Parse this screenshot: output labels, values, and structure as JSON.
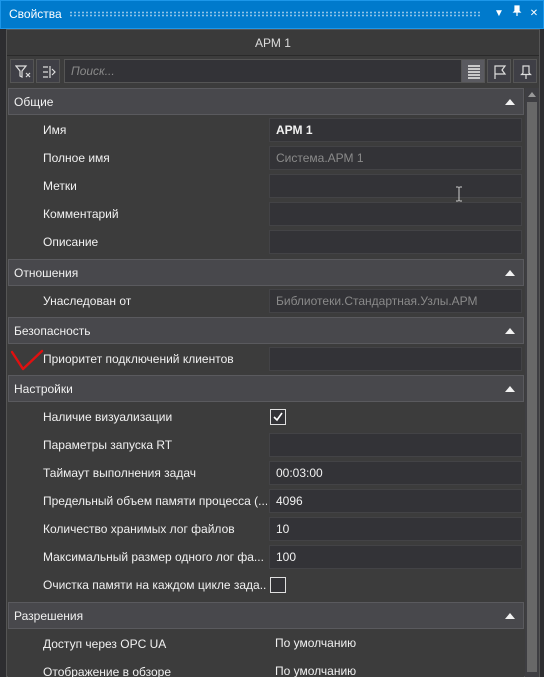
{
  "window": {
    "title": "Свойства"
  },
  "object_name": "АРМ 1",
  "search": {
    "placeholder": "Поиск..."
  },
  "categories": [
    {
      "label": "Общие",
      "rows": [
        {
          "label": "Имя",
          "value": "АРМ 1"
        },
        {
          "label": "Полное имя",
          "value": "Система.АРМ 1"
        },
        {
          "label": "Метки",
          "value": ""
        },
        {
          "label": "Комментарий",
          "value": ""
        },
        {
          "label": "Описание",
          "value": ""
        }
      ]
    },
    {
      "label": "Отношения",
      "rows": [
        {
          "label": "Унаследован от",
          "value": "Библиотеки.Стандартная.Узлы.АРМ"
        }
      ]
    },
    {
      "label": "Безопасность",
      "rows": [
        {
          "label": "Приоритет подключений клиентов",
          "value": ""
        }
      ]
    },
    {
      "label": "Настройки",
      "rows": [
        {
          "label": "Наличие визуализации",
          "checked": true
        },
        {
          "label": "Параметры запуска RT",
          "value": ""
        },
        {
          "label": "Таймаут выполнения задач",
          "value": "00:03:00"
        },
        {
          "label": "Предельный объем памяти процесса (...",
          "value": "4096"
        },
        {
          "label": "Количество хранимых лог файлов",
          "value": "10"
        },
        {
          "label": "Максимальный размер одного лог фа...",
          "value": "100"
        },
        {
          "label": "Очистка памяти на каждом цикле зада...",
          "checked": false
        }
      ]
    },
    {
      "label": "Разрешения",
      "rows": [
        {
          "label": "Доступ через OPC UA",
          "value": "По умолчанию"
        },
        {
          "label": "Отображение в обзоре",
          "value": "По умолчанию"
        }
      ]
    }
  ],
  "icons": {
    "filter": "filter-icon",
    "expand": "expand-icon",
    "categorized": "categorized-view-icon",
    "flag": "flag-icon",
    "pin": "pin-icon"
  },
  "colors": {
    "accent": "#007acc",
    "mark": "#e01010"
  }
}
